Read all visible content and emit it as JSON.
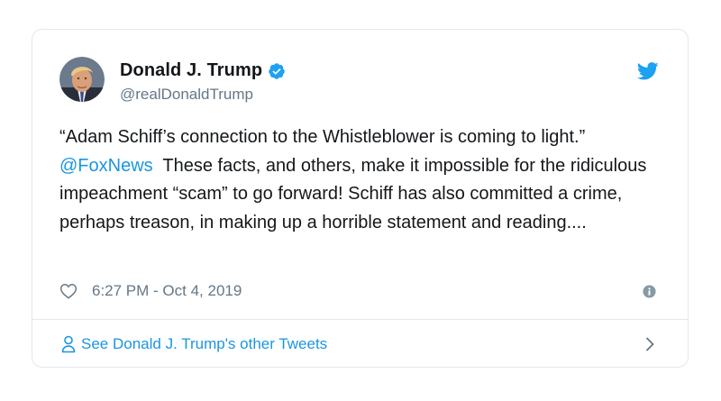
{
  "author": {
    "display_name": "Donald J. Trump",
    "handle": "@realDonaldTrump",
    "verified": true
  },
  "tweet": {
    "text_part1": "“Adam Schiff’s connection to the Whistleblower is coming to light.” ",
    "mention": "@FoxNews",
    "text_part2": "  These facts, and others, make it impossible for the ridiculous impeachment “scam” to go forward! Schiff has also committed a crime, perhaps treason, in making up a horrible statement and reading...."
  },
  "meta": {
    "timestamp": "6:27 PM - Oct 4, 2019"
  },
  "footer": {
    "label": "See Donald J. Trump's other Tweets"
  },
  "icons": {
    "brand": "twitter-bird-icon",
    "verified": "verified-badge-icon",
    "like": "heart-icon",
    "info": "info-icon",
    "person": "person-icon",
    "chevron": "chevron-right-icon"
  },
  "colors": {
    "brand_blue": "#1da1f2",
    "link_blue": "#1b95e0",
    "text": "#14171a",
    "muted": "#657786",
    "border": "#e1e8ed"
  }
}
